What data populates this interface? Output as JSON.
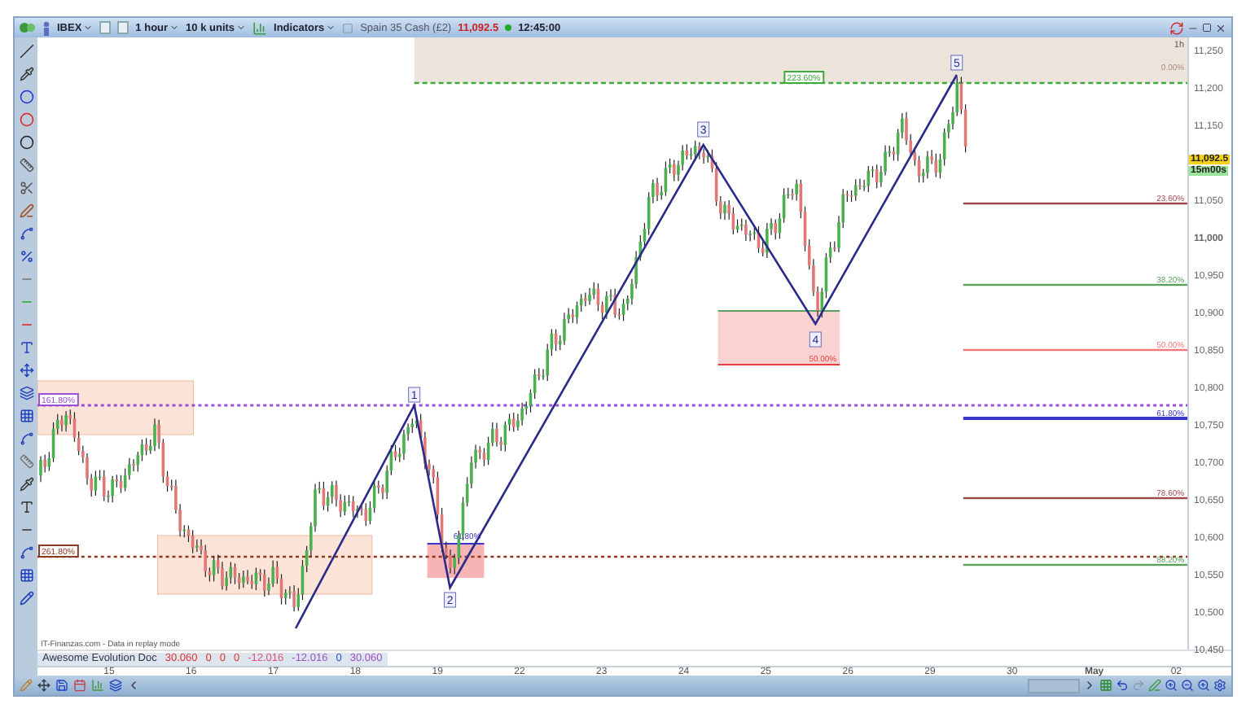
{
  "toolbar": {
    "symbol": "IBEX",
    "timeframe": "1 hour",
    "units": "10 k units",
    "indicators": "Indicators",
    "instrument": "Spain 35 Cash (£2)",
    "price": "11,092.5",
    "time": "12:45:00"
  },
  "chart": {
    "timeframe_label": "1h",
    "source_note": "IT-Finanzas.com - Data in replay mode",
    "top_label": "0.00%",
    "waves": [
      "1",
      "2",
      "3",
      "4",
      "5"
    ],
    "extension_labels": [
      {
        "label": "223.60%",
        "color": "#3caa3c"
      },
      {
        "label": "161.80%",
        "color": "#9b4fd6"
      },
      {
        "label": "261.80%",
        "color": "#8b3a22"
      }
    ],
    "zone_labels": [
      "61.80%",
      "50.00%"
    ],
    "fib_levels": [
      {
        "label": "23.60%",
        "color": "#a04848"
      },
      {
        "label": "38.20%",
        "color": "#5aa05a"
      },
      {
        "label": "50.00%",
        "color": "#f07878"
      },
      {
        "label": "61.80%",
        "color": "#3838c8"
      },
      {
        "label": "78.60%",
        "color": "#a04848"
      },
      {
        "label": "88.20%",
        "color": "#5aa05a"
      }
    ]
  },
  "price_axis": {
    "ticks": [
      "11,250",
      "11,200",
      "11,150",
      "11,050",
      "11,000",
      "10,950",
      "10,900",
      "10,850",
      "10,800",
      "10,750",
      "10,700",
      "10,650",
      "10,600",
      "10,550",
      "10,500",
      "10,450"
    ],
    "last_price": "11,092.5",
    "countdown": "15m00s"
  },
  "indicator": {
    "name": "Awesome Evolution Doc",
    "values": [
      {
        "value": "30.060",
        "color": "#e03030"
      },
      {
        "value": "0",
        "color": "#e03030"
      },
      {
        "value": "0",
        "color": "#e03030"
      },
      {
        "value": "0",
        "color": "#e03030"
      },
      {
        "value": "-12.016",
        "color": "#e0507a"
      },
      {
        "value": "-12.016",
        "color": "#a050c0"
      },
      {
        "value": "0",
        "color": "#3050d0"
      },
      {
        "value": "30.060",
        "color": "#a050c0"
      }
    ]
  },
  "date_axis": [
    "15",
    "16",
    "17",
    "18",
    "19",
    "22",
    "23",
    "24",
    "25",
    "26",
    "29",
    "30",
    "May",
    "02"
  ]
}
